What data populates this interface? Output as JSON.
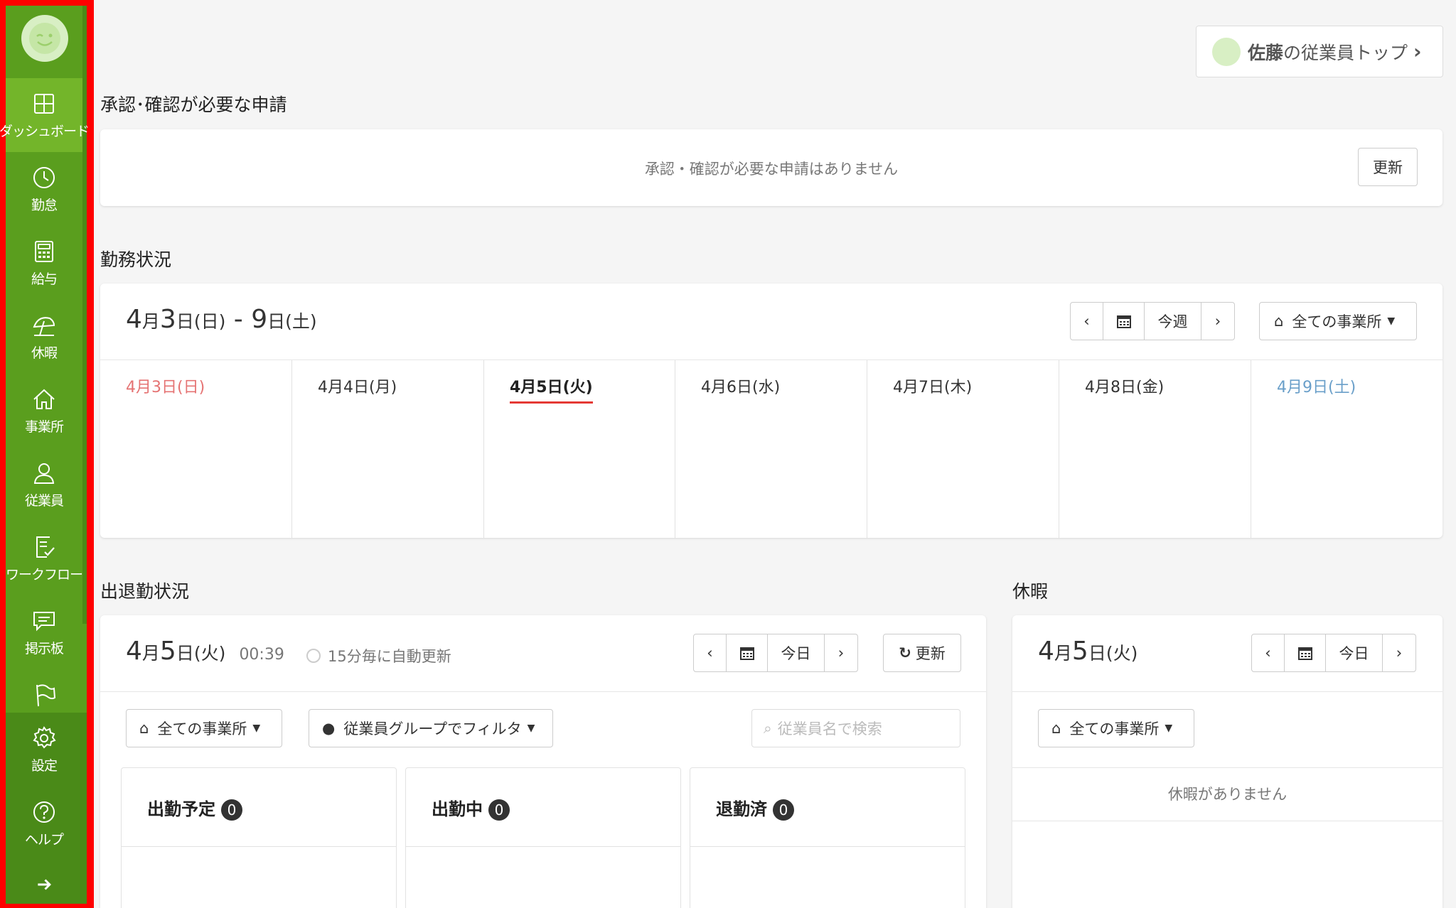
{
  "sidebar": {
    "items": [
      {
        "label": "ダッシュボード",
        "icon": "dashboard-icon"
      },
      {
        "label": "勤怠",
        "icon": "clock-icon"
      },
      {
        "label": "給与",
        "icon": "calculator-icon"
      },
      {
        "label": "休暇",
        "icon": "umbrella-icon"
      },
      {
        "label": "事業所",
        "icon": "home-icon"
      },
      {
        "label": "従業員",
        "icon": "user-icon"
      },
      {
        "label": "ワークフロー",
        "icon": "checklist-icon"
      },
      {
        "label": "掲示板",
        "icon": "message-icon"
      },
      {
        "label": "",
        "icon": "flag-icon"
      },
      {
        "label": "設定",
        "icon": "gear-icon"
      },
      {
        "label": "ヘルプ",
        "icon": "help-icon"
      }
    ],
    "expand_icon": "arrow-right-icon",
    "accent": "#5a9e1e",
    "active": "#73b52a",
    "highlight_border": "#ff0000"
  },
  "header": {
    "employee_name": "佐藤",
    "employee_top_suffix": "の従業員トップ"
  },
  "approvals": {
    "title": "承認･確認が必要な申請",
    "empty_text": "承認・確認が必要な申請はありません",
    "refresh_label": "更新"
  },
  "work_status": {
    "title": "勤務状況",
    "range": {
      "m1": "4",
      "t1": "月",
      "d1": "3",
      "t2": "日(日)",
      "sep": " - ",
      "d2": "9",
      "t3": "日(土)"
    },
    "this_week_label": "今週",
    "office_filter": "全ての事業所",
    "days": [
      "4月3日(日)",
      "4月4日(月)",
      "4月5日(火)",
      "4月6日(水)",
      "4月7日(木)",
      "4月8日(金)",
      "4月9日(土)"
    ]
  },
  "attendance": {
    "title": "出退勤状況",
    "date": {
      "m": "4",
      "t1": "月",
      "d": "5",
      "t2": "日(火)"
    },
    "time": "00:39",
    "auto_update": "15分毎に自動更新",
    "today_label": "今日",
    "refresh_label": "更新",
    "office_filter": "全ての事業所",
    "group_filter": "従業員グループでフィルタ",
    "search_placeholder": "従業員名で検索",
    "columns": [
      {
        "label": "出勤予定",
        "count": "0"
      },
      {
        "label": "出勤中",
        "count": "0"
      },
      {
        "label": "退勤済",
        "count": "0"
      }
    ]
  },
  "leave": {
    "title": "休暇",
    "date": {
      "m": "4",
      "t1": "月",
      "d": "5",
      "t2": "日(火)"
    },
    "today_label": "今日",
    "office_filter": "全ての事業所",
    "empty_text": "休暇がありません"
  }
}
